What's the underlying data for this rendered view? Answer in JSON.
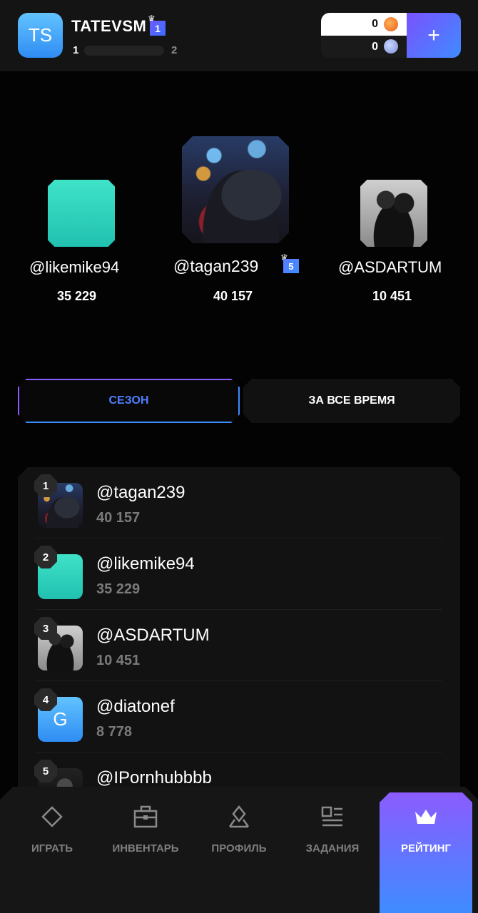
{
  "header": {
    "avatar_initials": "TS",
    "username": "TATEVSM",
    "level_badge": "1",
    "level_from": "1",
    "level_to": "2",
    "level_progress": 0,
    "wallet": {
      "coins": "0",
      "gems": "0",
      "add_label": "+"
    }
  },
  "podium": [
    {
      "place": 2,
      "name": "@likemike94",
      "score": "35 229",
      "avatar": "teal"
    },
    {
      "place": 1,
      "name": "@tagan239",
      "score": "40 157",
      "badge": "5",
      "avatar": "photo"
    },
    {
      "place": 3,
      "name": "@ASDARTUM",
      "score": "10 451",
      "avatar": "photo-bw"
    }
  ],
  "tabs": {
    "season": "СЕЗОН",
    "all_time": "ЗА ВСЕ ВРЕМЯ",
    "active": "season"
  },
  "leaderboard": [
    {
      "rank": "1",
      "name": "@tagan239",
      "score": "40 157"
    },
    {
      "rank": "2",
      "name": "@likemike94",
      "score": "35 229"
    },
    {
      "rank": "3",
      "name": "@ASDARTUM",
      "score": "10 451"
    },
    {
      "rank": "4",
      "name": "@diatonef",
      "score": "8 778",
      "avatar_letter": "G"
    },
    {
      "rank": "5",
      "name": "@IPornhubbbb",
      "score": ""
    }
  ],
  "nav": {
    "play": "ИГРАТЬ",
    "inventory": "ИНВЕНТАРЬ",
    "profile": "ПРОФИЛЬ",
    "tasks": "ЗАДАНИЯ",
    "rating": "РЕЙТИНГ",
    "active": "rating"
  },
  "colors": {
    "accent_purple": "#8b5cff",
    "accent_blue": "#3e8cff",
    "teal": "#2fd3bd",
    "background": "#030303"
  }
}
